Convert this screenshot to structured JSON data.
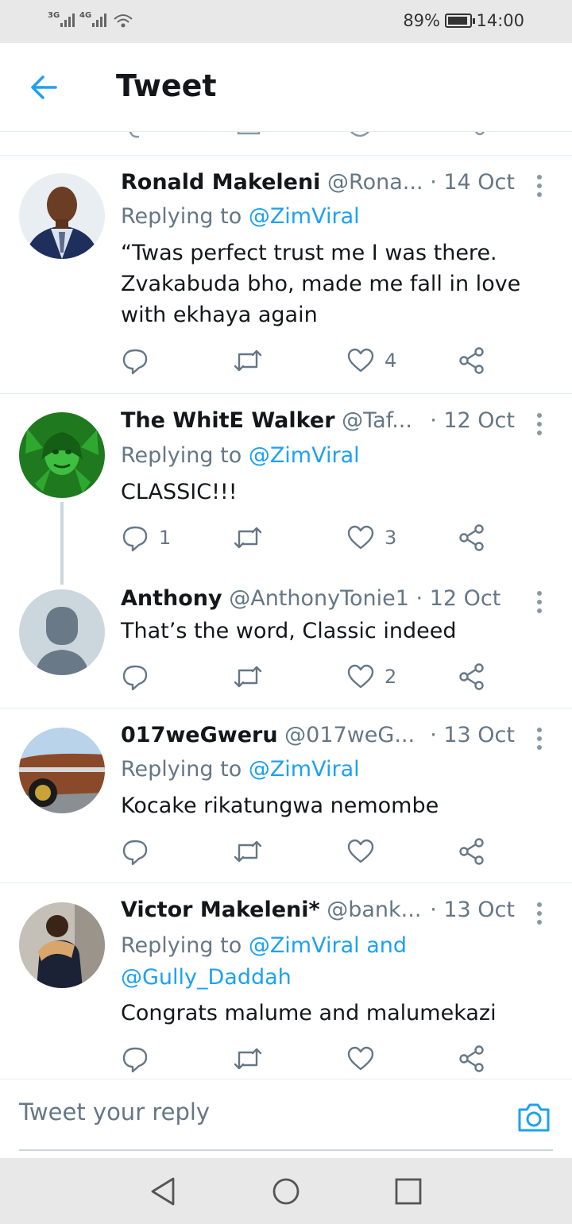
{
  "status_bar": {
    "network1": "3G",
    "network2": "4G",
    "battery": "89%",
    "time": "14:00"
  },
  "header": {
    "title": "Tweet"
  },
  "tweets": [
    {
      "name": "Ronald Makeleni",
      "handle": "@Rona...",
      "date": "· 14 Oct",
      "replying_label": "Replying to ",
      "replying_to": "@ZimViral",
      "text": "“Twas perfect trust me I was there. Zvakabuda bho, made me fall in love with ekhaya again",
      "reply_count": "",
      "retweet_count": "",
      "like_count": "4"
    },
    {
      "name": "The WhitE Walker",
      "handle": "@Taf...",
      "date": "· 12 Oct",
      "replying_label": "Replying to ",
      "replying_to": "@ZimViral",
      "text": "CLASSIC!!!",
      "reply_count": "1",
      "retweet_count": "",
      "like_count": "3"
    },
    {
      "name": "Anthony",
      "handle": "@AnthonyTonie1",
      "date": "· 12 Oct",
      "text": "That’s the word, Classic indeed",
      "reply_count": "",
      "retweet_count": "",
      "like_count": "2"
    },
    {
      "name": "017weGweru",
      "handle": "@017weG...",
      "date": "· 13 Oct",
      "replying_label": "Replying to ",
      "replying_to": "@ZimViral",
      "text": "Kocake rikatungwa nemombe",
      "reply_count": "",
      "retweet_count": "",
      "like_count": ""
    },
    {
      "name": "Victor Makeleni*",
      "handle": "@bank...",
      "date": "· 13 Oct",
      "replying_label": "Replying to ",
      "replying_to": "@ZimViral",
      "replying_and": " and",
      "replying_to2": "@Gully_Daddah",
      "text": "Congrats malume and malumekazi",
      "reply_count": "",
      "retweet_count": "",
      "like_count": ""
    }
  ],
  "reply_bar": {
    "placeholder": "Tweet your reply"
  },
  "icons": {
    "back": "arrow-left-icon",
    "reply": "reply-icon",
    "retweet": "retweet-icon",
    "like": "heart-icon",
    "share": "share-icon",
    "camera": "camera-icon",
    "more": "more-vertical-icon"
  },
  "colors": {
    "accent": "#1da1f2",
    "secondary_text": "#657786",
    "icon": "#657786"
  }
}
